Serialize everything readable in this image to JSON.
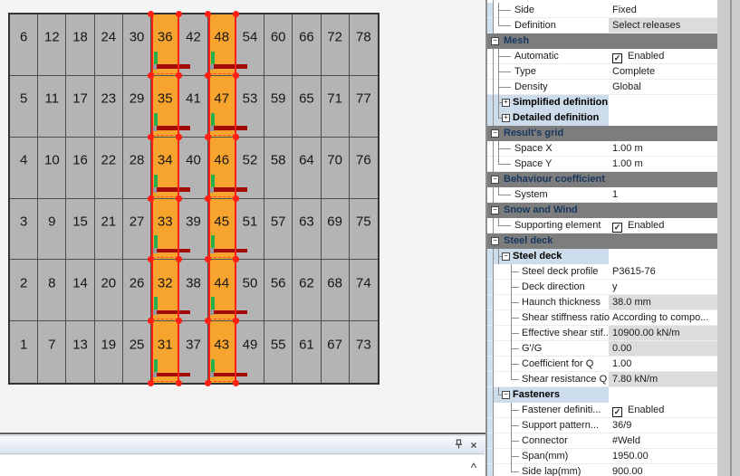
{
  "grid": {
    "rows": 6,
    "cols": 13,
    "numbers": [
      [
        6,
        12,
        18,
        24,
        30,
        36,
        42,
        48,
        54,
        60,
        66,
        72,
        78
      ],
      [
        5,
        11,
        17,
        23,
        29,
        35,
        41,
        47,
        53,
        59,
        65,
        71,
        77
      ],
      [
        4,
        10,
        16,
        22,
        28,
        34,
        40,
        46,
        52,
        58,
        64,
        70,
        76
      ],
      [
        3,
        9,
        15,
        21,
        27,
        33,
        39,
        45,
        51,
        57,
        63,
        69,
        75
      ],
      [
        2,
        8,
        14,
        20,
        26,
        32,
        38,
        44,
        50,
        56,
        62,
        68,
        74
      ],
      [
        1,
        7,
        13,
        19,
        25,
        31,
        37,
        43,
        49,
        55,
        61,
        67,
        73
      ]
    ],
    "highlighted_columns": [
      5,
      7
    ],
    "highlighted_cells": [
      31,
      32,
      33,
      34,
      35,
      36,
      43,
      44,
      45,
      46,
      47,
      48
    ],
    "colors": {
      "cell": "#b4b4b4",
      "line": "#4d4d4d",
      "highlight": "#f6a42d",
      "selection_red": "#ff1f14",
      "axis_x_darkred": "#a30a05",
      "axis_y_green": "#22b14c",
      "origin_gray": "#9b9b9b"
    }
  },
  "properties": {
    "rows": [
      {
        "kind": "item",
        "level": 1,
        "label": "Side",
        "value": "Fixed",
        "branch": "mid",
        "gutter": true
      },
      {
        "kind": "item",
        "level": 1,
        "label": "Definition",
        "value": "Select releases",
        "gray": true,
        "branch": "end",
        "gutter": true
      },
      {
        "kind": "header",
        "label": "Mesh",
        "icon": "−"
      },
      {
        "kind": "item",
        "level": 1,
        "label": "Automatic",
        "checkbox": true,
        "value": "Enabled",
        "branch": "mid"
      },
      {
        "kind": "item",
        "level": 1,
        "label": "Type",
        "value": "Complete",
        "branch": "mid"
      },
      {
        "kind": "item",
        "level": 1,
        "label": "Density",
        "value": "Global",
        "branch": "mid"
      },
      {
        "kind": "sub",
        "label": "Simplified definition",
        "icon": "+",
        "branch": "mid"
      },
      {
        "kind": "sub",
        "label": "Detailed definition",
        "icon": "+",
        "branch": "end"
      },
      {
        "kind": "header",
        "label": "Result's grid",
        "icon": "−"
      },
      {
        "kind": "item",
        "level": 1,
        "label": "Space X",
        "value": "1.00 m",
        "branch": "mid"
      },
      {
        "kind": "item",
        "level": 1,
        "label": "Space Y",
        "value": "1.00 m",
        "branch": "end"
      },
      {
        "kind": "header",
        "label": "Behaviour coefficient",
        "icon": "−"
      },
      {
        "kind": "item",
        "level": 1,
        "label": "System",
        "value": "1",
        "branch": "end"
      },
      {
        "kind": "header",
        "label": "Snow and Wind",
        "icon": "−"
      },
      {
        "kind": "item",
        "level": 1,
        "label": "Supporting element",
        "checkbox": true,
        "value": "Enabled",
        "branch": "end"
      },
      {
        "kind": "header",
        "label": "Steel deck",
        "icon": "−"
      },
      {
        "kind": "sub",
        "label": "Steel deck",
        "icon": "−",
        "branch": "mid",
        "gutter": true
      },
      {
        "kind": "item",
        "level": 2,
        "label": "Steel deck profile",
        "value": "P3615-76",
        "branch": "mid",
        "gutter": true
      },
      {
        "kind": "item",
        "level": 2,
        "label": "Deck direction",
        "value": "y",
        "branch": "mid",
        "gutter": true
      },
      {
        "kind": "item",
        "level": 2,
        "label": "Haunch thickness",
        "value": "38.0 mm",
        "gray": true,
        "branch": "mid",
        "gutter": true
      },
      {
        "kind": "item",
        "level": 2,
        "label": "Shear stiffness ratio",
        "value": "According to compo...",
        "branch": "mid",
        "gutter": true
      },
      {
        "kind": "item",
        "level": 2,
        "label": "Effective shear stif...",
        "value": "10900.00 kN/m",
        "gray": true,
        "branch": "mid",
        "gutter": true
      },
      {
        "kind": "item",
        "level": 2,
        "label": "G'/G",
        "value": "0.00",
        "gray": true,
        "branch": "mid",
        "gutter": true
      },
      {
        "kind": "item",
        "level": 2,
        "label": "Coefficient for Q",
        "value": "1.00",
        "branch": "mid",
        "gutter": true
      },
      {
        "kind": "item",
        "level": 2,
        "label": "Shear resistance Q",
        "value": "7.80 kN/m",
        "gray": true,
        "branch": "end",
        "gutter": true
      },
      {
        "kind": "sub",
        "label": "Fasteners",
        "icon": "−",
        "branch": "end",
        "gutter": true
      },
      {
        "kind": "item",
        "level": 2,
        "label": "Fastener definiti...",
        "checkbox": true,
        "value": "Enabled",
        "branch": "mid",
        "gutter": true
      },
      {
        "kind": "item",
        "level": 2,
        "label": "Support pattern...",
        "value": "36/9",
        "branch": "mid",
        "gutter": true
      },
      {
        "kind": "item",
        "level": 2,
        "label": "Connector",
        "value": "#Weld",
        "branch": "mid",
        "gutter": true
      },
      {
        "kind": "item",
        "level": 2,
        "label": "Span(mm)",
        "value": "1950.00",
        "branch": "mid",
        "gutter": true
      },
      {
        "kind": "item",
        "level": 2,
        "label": "Side lap(mm)",
        "value": "900.00",
        "branch": "end",
        "gutter": true
      }
    ],
    "checkbox_glyph": "✓",
    "header_bg": "#7d7d7d",
    "header_text": "#17375e",
    "subheader_bg": "#cddcea",
    "readonly_bg": "#dcdcdc"
  },
  "bottom_panel": {
    "close_glyph": "×",
    "scroll_up_glyph": "∧"
  }
}
